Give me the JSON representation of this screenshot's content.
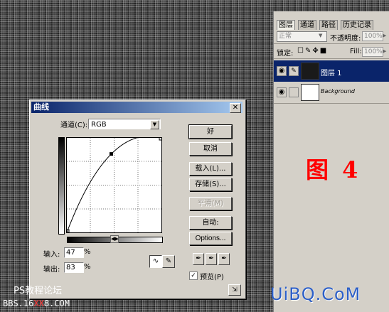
{
  "layers_panel": {
    "tabs": [
      "图层",
      "通道",
      "路径",
      "历史记录"
    ],
    "blend_mode": "正常",
    "opacity_label": "不透明度:",
    "opacity_value": "100%",
    "lock_label": "锁定:",
    "fill_label": "Fill:",
    "fill_value": "100%",
    "layers": [
      {
        "name": "图层 1",
        "selected": true,
        "thumb_color": "#1a1a1a"
      },
      {
        "name": "Background",
        "selected": false,
        "thumb_color": "#ffffff"
      }
    ]
  },
  "figure_label": "图 4",
  "curves_dialog": {
    "title": "曲线",
    "channel_label": "通道(C):",
    "channel_value": "RGB",
    "input_label": "输入:",
    "input_value": "47",
    "output_label": "输出:",
    "output_value": "83",
    "percent": "%",
    "buttons": {
      "ok": "好",
      "cancel": "取消",
      "load": "载入(L)...",
      "save": "存储(S)...",
      "smooth": "平滑(M)",
      "auto": "自动:",
      "options": "Options..."
    },
    "preview_label": "预览(P)",
    "preview_checked": true,
    "curve_control_point": {
      "input": 47,
      "output": 83
    }
  },
  "watermark": {
    "forum_cn": "PS教程论坛",
    "bbs_prefix": "BBS.16",
    "bbs_red": "XX",
    "bbs_suffix": "8.COM",
    "logo": "UiBQ.CoM"
  }
}
